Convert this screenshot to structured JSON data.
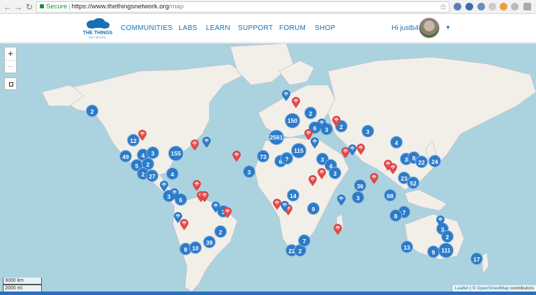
{
  "browser": {
    "secure_label": "Secure",
    "url_host": "https://www.thethingsnetwork.org",
    "url_path": "/map"
  },
  "header": {
    "logo_text_line1": "THE THINGS",
    "logo_text_line2": "NETWORK",
    "nav": [
      "COMMUNITIES",
      "LABS",
      "LEARN",
      "SUPPORT",
      "FORUM",
      "SHOP"
    ],
    "user_greeting": "Hi justb4"
  },
  "map": {
    "zoom_in": "+",
    "zoom_out": "−",
    "scale_km": "3000 km",
    "scale_mi": "2000 mi",
    "attribution_leaflet": "Leaflet",
    "attribution_sep": " | © ",
    "attribution_osm": "OpenStreetMap",
    "attribution_tail": " contributors",
    "clusters": [
      "2",
      "12",
      "49",
      "4",
      "3",
      "155",
      "5",
      "2",
      "2",
      "27",
      "4",
      "3",
      "6",
      "3",
      "2",
      "8",
      "10",
      "39",
      "2561",
      "150",
      "2",
      "6",
      "3",
      "2",
      "3",
      "73",
      "6",
      "?",
      "115",
      "3",
      "4",
      "3",
      "3",
      "14",
      "9",
      "36",
      "3",
      "68",
      "7",
      "8",
      "22",
      "2",
      "7",
      "13",
      "9",
      "111",
      "3",
      "2",
      "17",
      "23",
      "52",
      "4",
      "3",
      "8",
      "22",
      "24"
    ]
  },
  "colors": {
    "cluster": "#2c7bc9",
    "pin_red": "#e0494a",
    "pin_blue": "#2c7bc9",
    "water": "#aad3df",
    "land": "#f2efe9",
    "link": "#1770b4"
  }
}
